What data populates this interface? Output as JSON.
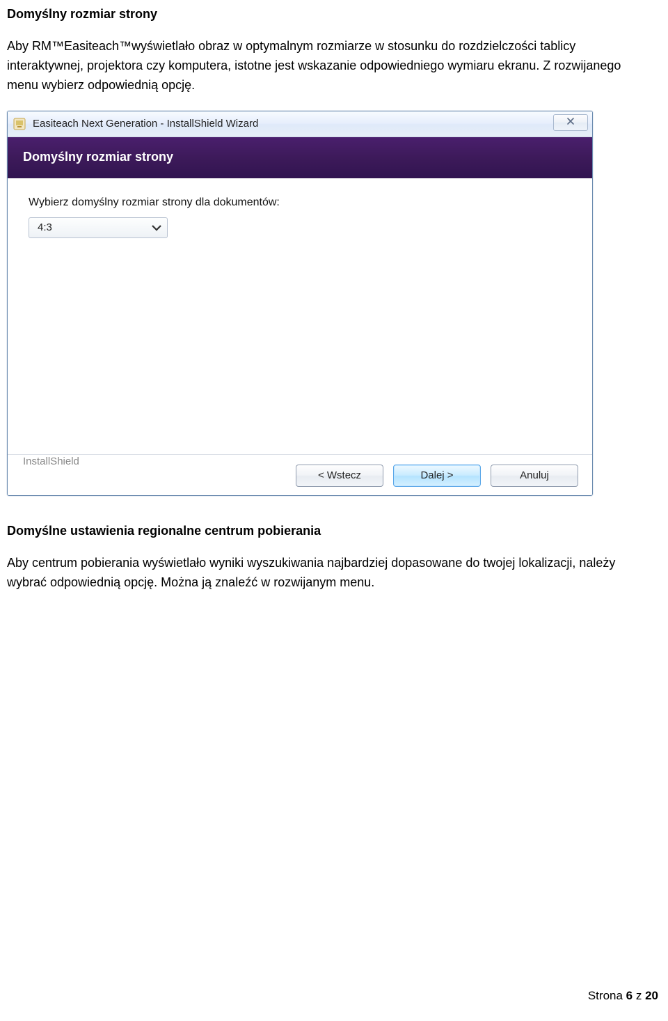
{
  "section1": {
    "heading": "Domyślny rozmiar strony",
    "paragraph": "Aby RM™Easiteach™wyświetlało obraz w optymalnym rozmiarze w stosunku do rozdzielczości tablicy interaktywnej, projektora czy komputera, istotne jest wskazanie odpowiedniego wymiaru ekranu. Z rozwijanego menu wybierz odpowiednią opcję."
  },
  "dialog": {
    "title": "Easiteach Next Generation - InstallShield Wizard",
    "header_title": "Domyślny rozmiar strony",
    "field_label": "Wybierz domyślny rozmiar strony dla dokumentów:",
    "combo_value": "4:3",
    "brand": "InstallShield",
    "buttons": {
      "back": "< Wstecz",
      "next": "Dalej >",
      "cancel": "Anuluj"
    }
  },
  "section2": {
    "heading": "Domyślne ustawienia regionalne centrum pobierania",
    "paragraph": "Aby centrum pobierania wyświetlało wyniki wyszukiwania najbardziej dopasowane do twojej lokalizacji, należy wybrać odpowiednią opcję. Można ją znaleźć w rozwijanym menu."
  },
  "footer": {
    "prefix": "Strona ",
    "current": "6",
    "sep": " z ",
    "total": "20"
  }
}
